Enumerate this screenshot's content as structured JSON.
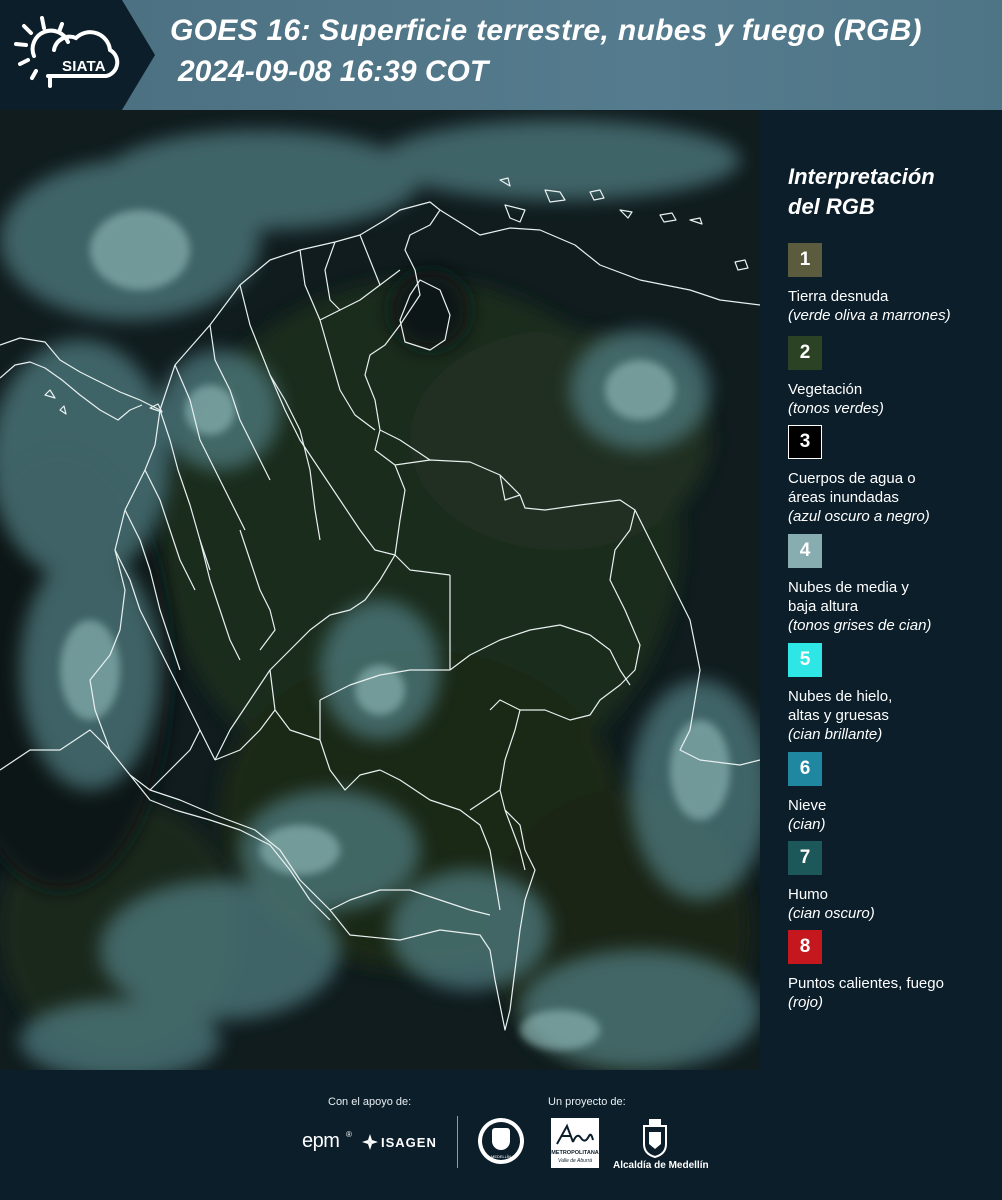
{
  "header": {
    "logo_text": "SIATA",
    "title": "GOES 16: Superficie terrestre, nubes y fuego (RGB)",
    "datetime": "2024-09-08 16:39 COT"
  },
  "legend": {
    "title_line1": "Interpretación",
    "title_line2": "del RGB",
    "items": [
      {
        "num": "1",
        "color": "#5b5b3e",
        "label": "Tierra desnuda",
        "sub": "(verde oliva a marrones)"
      },
      {
        "num": "2",
        "color": "#2b4324",
        "label": "Vegetación",
        "sub": "(tonos verdes)"
      },
      {
        "num": "3",
        "color": "#000000",
        "label": "Cuerpos de agua o áreas inundadas",
        "sub": "(azul oscuro a negro)"
      },
      {
        "num": "4",
        "color": "#88adb0",
        "label": "Nubes de media y baja altura",
        "sub": "(tonos grises de cian)"
      },
      {
        "num": "5",
        "color": "#2fe6e6",
        "label": "Nubes de hielo, altas y gruesas",
        "sub": "(cian brillante)"
      },
      {
        "num": "6",
        "color": "#1f88a0",
        "label": "Nieve",
        "sub": "(cian)"
      },
      {
        "num": "7",
        "color": "#1c5759",
        "label": "Humo",
        "sub": "(cian oscuro)"
      },
      {
        "num": "8",
        "color": "#c4181e",
        "label": "Puntos calientes, fuego",
        "sub": "(rojo)"
      }
    ]
  },
  "footer": {
    "support_label": "Con el apoyo de:",
    "project_label": "Un proyecto de:",
    "epm": "epm",
    "isagen": "ISAGEN",
    "area_metro": "METROPOLITANA",
    "area_metro_sub": "Valle de Aburrá",
    "alcaldia": "Alcaldía de Medellín",
    "medellin_seal": "MEDELLÍN"
  }
}
